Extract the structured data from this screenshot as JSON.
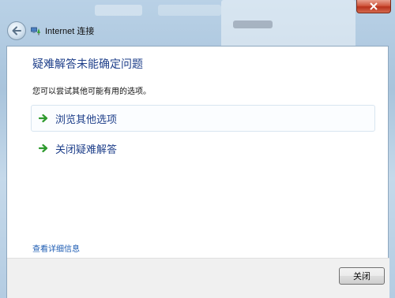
{
  "window": {
    "title": "Internet 连接"
  },
  "dialog": {
    "heading": "疑难解答未能确定问题",
    "subtext": "您可以尝试其他可能有用的选项。",
    "options": [
      {
        "label": "浏览其他选项"
      },
      {
        "label": "关闭疑难解答"
      }
    ],
    "detail_link": "查看详细信息",
    "close_button": "关闭"
  },
  "colors": {
    "heading": "#1e3f8a",
    "link": "#1e5cb3",
    "arrow": "#2e9a2e",
    "close_button": "#c4402a"
  },
  "icons": {
    "back": "back-arrow-icon",
    "network": "network-icon",
    "close": "close-icon",
    "option_arrow": "green-arrow-icon"
  }
}
